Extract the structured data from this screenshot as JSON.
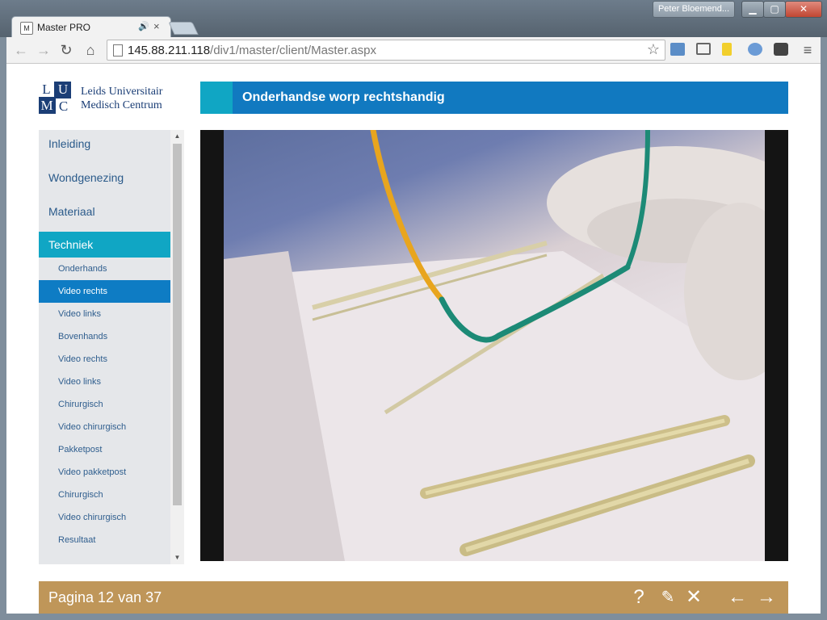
{
  "browser": {
    "tab_title": "Master PRO",
    "favicon_letter": "M",
    "audio_icon": "speaker-icon",
    "close_glyph": "×",
    "user_name": "Peter Bloemend...",
    "url_host": "145.88.211.118",
    "url_path": "/div1/master/client/Master.aspx"
  },
  "header": {
    "logo_letters": [
      "L",
      "U",
      "M",
      "C"
    ],
    "logo_line1": "Leids Universitair",
    "logo_line2": "Medisch Centrum",
    "title": "Onderhandse worp rechtshandig"
  },
  "sidebar": {
    "main_items": [
      {
        "label": "Inleiding",
        "active": false
      },
      {
        "label": "Wondgenezing",
        "active": false
      },
      {
        "label": "Materiaal",
        "active": false
      },
      {
        "label": "Techniek",
        "active": true
      }
    ],
    "sub_items": [
      {
        "label": "Onderhands",
        "active": false
      },
      {
        "label": "Video rechts",
        "active": true
      },
      {
        "label": "Video links",
        "active": false
      },
      {
        "label": "Bovenhands",
        "active": false
      },
      {
        "label": "Video rechts",
        "active": false
      },
      {
        "label": "Video links",
        "active": false
      },
      {
        "label": "Chirurgisch",
        "active": false
      },
      {
        "label": "Video chirurgisch",
        "active": false
      },
      {
        "label": "Pakketpost",
        "active": false
      },
      {
        "label": "Video pakketpost",
        "active": false
      },
      {
        "label": "Chirurgisch",
        "active": false
      },
      {
        "label": "Video chirurgisch",
        "active": false
      },
      {
        "label": "Resultaat",
        "active": false
      }
    ]
  },
  "footer": {
    "page_counter": "Pagina 12 van 37",
    "icons": [
      "help-icon",
      "notes-icon",
      "close-icon",
      "arrow-left-icon",
      "arrow-right-icon"
    ]
  },
  "colors": {
    "title_bar": "#1179c0",
    "accent": "#10a6c4",
    "active_sub": "#0e7cc4",
    "footer": "#bf9659",
    "logo_blue": "#1b3e76"
  }
}
